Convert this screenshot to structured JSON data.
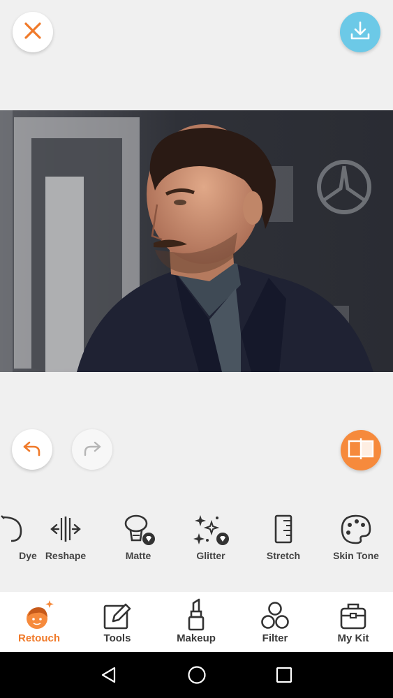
{
  "top_bar": {
    "close_icon": "close-icon",
    "download_icon": "download-icon"
  },
  "photo": {
    "subject": "man-portrait-photo"
  },
  "edit_controls": {
    "undo_icon": "undo-icon",
    "redo_icon": "redo-icon",
    "compare_icon": "compare-icon"
  },
  "tools": [
    {
      "label": "Dye",
      "icon": "dye-icon"
    },
    {
      "label": "Reshape",
      "icon": "reshape-icon"
    },
    {
      "label": "Matte",
      "icon": "matte-icon",
      "premium": true
    },
    {
      "label": "Glitter",
      "icon": "glitter-icon",
      "premium": true
    },
    {
      "label": "Stretch",
      "icon": "stretch-icon"
    },
    {
      "label": "Skin Tone",
      "icon": "skin-tone-icon"
    }
  ],
  "bottom_nav": [
    {
      "label": "Retouch",
      "icon": "retouch-icon",
      "active": true
    },
    {
      "label": "Tools",
      "icon": "tools-icon"
    },
    {
      "label": "Makeup",
      "icon": "makeup-icon"
    },
    {
      "label": "Filter",
      "icon": "filter-icon"
    },
    {
      "label": "My Kit",
      "icon": "my-kit-icon"
    }
  ],
  "system_nav": [
    "back-icon",
    "home-icon",
    "recents-icon"
  ],
  "colors": {
    "accent_orange": "#f07a2a",
    "download_blue": "#6cc9e7",
    "background": "#f0f0f0"
  }
}
